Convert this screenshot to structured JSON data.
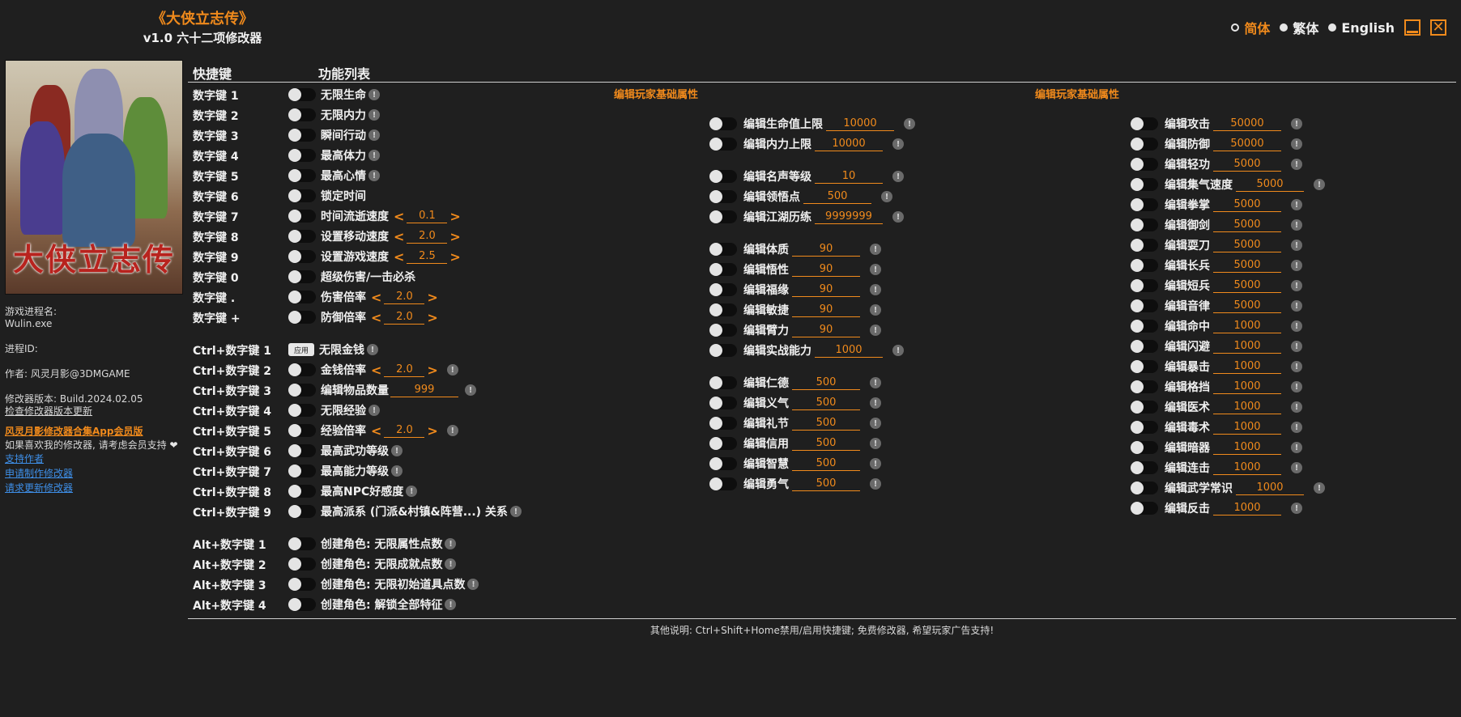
{
  "header": {
    "game_title": "《大侠立志传》",
    "subtitle": "v1.0 六十二项修改器"
  },
  "languages": [
    {
      "label": "简体",
      "active": true
    },
    {
      "label": "繁体",
      "active": false
    },
    {
      "label": "English",
      "active": false
    }
  ],
  "window_controls": {
    "minimize": "minimize",
    "close": "✕"
  },
  "sidebar": {
    "cover_title": "大侠立志传",
    "process_name_label": "游戏进程名:",
    "process_name": "Wulin.exe",
    "process_id_label": "进程ID:",
    "author": "作者: 风灵月影@3DMGAME",
    "version": "修改器版本: Build.2024.02.05",
    "check_update": "检查修改器版本更新",
    "app_link": "风灵月影修改器合集App会员版",
    "support_text": "如果喜欢我的修改器, 请考虑会员支持",
    "heart": "❤",
    "links": [
      "支持作者",
      "申请制作修改器",
      "请求更新修改器"
    ]
  },
  "columns": {
    "hotkey": "快捷键",
    "features": "功能列表"
  },
  "hotkeys": [
    {
      "key": "数字键 1",
      "label": "无限生命",
      "info": true
    },
    {
      "key": "数字键 2",
      "label": "无限内力",
      "info": true
    },
    {
      "key": "数字键 3",
      "label": "瞬间行动",
      "info": true
    },
    {
      "key": "数字键 4",
      "label": "最高体力",
      "info": true
    },
    {
      "key": "数字键 5",
      "label": "最高心情",
      "info": true
    },
    {
      "key": "数字键 6",
      "label": "锁定时间",
      "info": false
    },
    {
      "key": "数字键 7",
      "label": "时间流逝速度",
      "stepper": "0.1"
    },
    {
      "key": "数字键 8",
      "label": "设置移动速度",
      "stepper": "2.0"
    },
    {
      "key": "数字键 9",
      "label": "设置游戏速度",
      "stepper": "2.5"
    },
    {
      "key": "数字键 0",
      "label": "超级伤害/一击必杀",
      "info": false
    },
    {
      "key": "数字键 .",
      "label": "伤害倍率",
      "stepper": "2.0"
    },
    {
      "key": "数字键 +",
      "label": "防御倍率",
      "stepper": "2.0"
    },
    {
      "key": "Ctrl+数字键 1",
      "label": "无限金钱",
      "info": true,
      "apply": "应用"
    },
    {
      "key": "Ctrl+数字键 2",
      "label": "金钱倍率",
      "stepper": "2.0",
      "info": true
    },
    {
      "key": "Ctrl+数字键 3",
      "label": "编辑物品数量",
      "input": "999",
      "info": true
    },
    {
      "key": "Ctrl+数字键 4",
      "label": "无限经验",
      "info": true
    },
    {
      "key": "Ctrl+数字键 5",
      "label": "经验倍率",
      "stepper": "2.0",
      "info": true
    },
    {
      "key": "Ctrl+数字键 6",
      "label": "最高武功等级",
      "info": true
    },
    {
      "key": "Ctrl+数字键 7",
      "label": "最高能力等级",
      "info": true
    },
    {
      "key": "Ctrl+数字键 8",
      "label": "最高NPC好感度",
      "info": true
    },
    {
      "key": "Ctrl+数字键 9",
      "label": "最高派系 (门派&村镇&阵营...) 关系",
      "info": true
    },
    {
      "key": "Alt+数字键 1",
      "label": "创建角色: 无限属性点数",
      "info": true
    },
    {
      "key": "Alt+数字键 2",
      "label": "创建角色: 无限成就点数",
      "info": true
    },
    {
      "key": "Alt+数字键 3",
      "label": "创建角色: 无限初始道具点数",
      "info": true
    },
    {
      "key": "Alt+数字键 4",
      "label": "创建角色: 解锁全部特征",
      "info": true
    }
  ],
  "attr_section_mid": {
    "title": "编辑玩家基础属性",
    "items": [
      {
        "label": "编辑生命值上限",
        "value": "10000"
      },
      {
        "label": "编辑内力上限",
        "value": "10000"
      },
      {
        "label": "编辑名声等级",
        "value": "10"
      },
      {
        "label": "编辑领悟点",
        "value": "500"
      },
      {
        "label": "编辑江湖历练",
        "value": "9999999"
      },
      {
        "label": "编辑体质",
        "value": "90"
      },
      {
        "label": "编辑悟性",
        "value": "90"
      },
      {
        "label": "编辑福缘",
        "value": "90"
      },
      {
        "label": "编辑敏捷",
        "value": "90"
      },
      {
        "label": "编辑臂力",
        "value": "90"
      },
      {
        "label": "编辑实战能力",
        "value": "1000"
      },
      {
        "label": "编辑仁德",
        "value": "500"
      },
      {
        "label": "编辑义气",
        "value": "500"
      },
      {
        "label": "编辑礼节",
        "value": "500"
      },
      {
        "label": "编辑信用",
        "value": "500"
      },
      {
        "label": "编辑智慧",
        "value": "500"
      },
      {
        "label": "编辑勇气",
        "value": "500"
      }
    ]
  },
  "attr_section_right": {
    "title": "编辑玩家基础属性",
    "items": [
      {
        "label": "编辑攻击",
        "value": "50000"
      },
      {
        "label": "编辑防御",
        "value": "50000"
      },
      {
        "label": "编辑轻功",
        "value": "5000"
      },
      {
        "label": "编辑集气速度",
        "value": "5000"
      },
      {
        "label": "编辑拳掌",
        "value": "5000"
      },
      {
        "label": "编辑御剑",
        "value": "5000"
      },
      {
        "label": "编辑耍刀",
        "value": "5000"
      },
      {
        "label": "编辑长兵",
        "value": "5000"
      },
      {
        "label": "编辑短兵",
        "value": "5000"
      },
      {
        "label": "编辑音律",
        "value": "5000"
      },
      {
        "label": "编辑命中",
        "value": "1000"
      },
      {
        "label": "编辑闪避",
        "value": "1000"
      },
      {
        "label": "编辑暴击",
        "value": "1000"
      },
      {
        "label": "编辑格挡",
        "value": "1000"
      },
      {
        "label": "编辑医术",
        "value": "1000"
      },
      {
        "label": "编辑毒术",
        "value": "1000"
      },
      {
        "label": "编辑暗器",
        "value": "1000"
      },
      {
        "label": "编辑连击",
        "value": "1000"
      },
      {
        "label": "编辑武学常识",
        "value": "1000"
      },
      {
        "label": "编辑反击",
        "value": "1000"
      }
    ]
  },
  "footer": "其他说明: Ctrl+Shift+Home禁用/启用快捷键; 免费修改器, 希望玩家广告支持!",
  "colors": {
    "accent": "#f08a1c",
    "background": "#1f1f1f",
    "link": "#3e8fe8"
  }
}
